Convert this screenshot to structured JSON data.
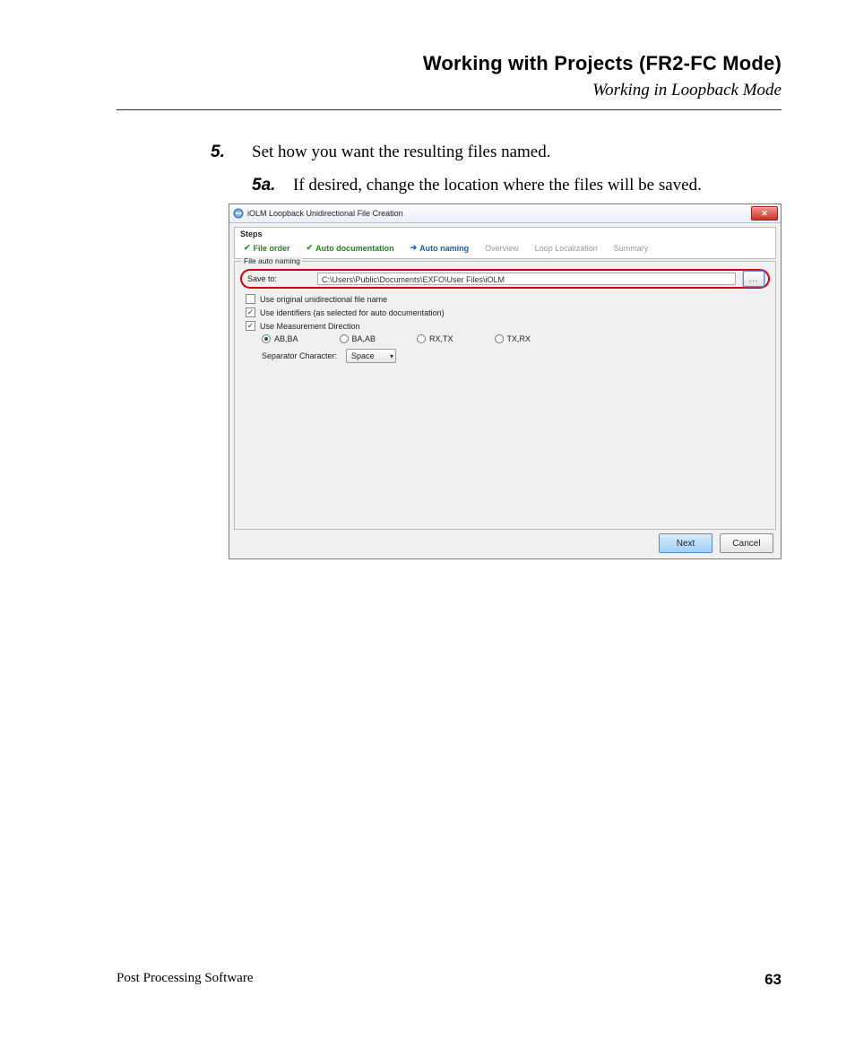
{
  "header": {
    "title": "Working with Projects (FR2-FC Mode)",
    "subtitle": "Working in Loopback Mode"
  },
  "body": {
    "step_num": "5.",
    "step_text": "Set how you want the resulting files named.",
    "substep_num": "5a.",
    "substep_text": "If desired, change the location where the files will be saved."
  },
  "window": {
    "title": "iOLM Loopback Unidirectional File Creation",
    "close": "✕",
    "steps_label": "Steps",
    "steps": {
      "file_order": "File order",
      "auto_doc": "Auto documentation",
      "auto_naming": "Auto naming",
      "overview": "Overview",
      "loop_loc": "Loop Localization",
      "summary": "Summary"
    },
    "panel_legend": "File auto naming",
    "save_to_label": "Save to:",
    "save_to_value": "C:\\Users\\Public\\Documents\\EXFO\\User Files\\iOLM",
    "browse_btn": "...",
    "chk_orig": "Use original unidirectional file name",
    "chk_ident": "Use identifiers (as selected for auto documentation)",
    "chk_dir": "Use Measurement Direction",
    "radios": {
      "abba": "AB,BA",
      "baab": "BA,AB",
      "rxtx": "RX,TX",
      "txrx": "TX,RX"
    },
    "sep_label": "Separator Character:",
    "sep_value": "Space",
    "btn_next": "Next",
    "btn_cancel": "Cancel"
  },
  "footer": {
    "product": "Post Processing Software",
    "page": "63"
  }
}
